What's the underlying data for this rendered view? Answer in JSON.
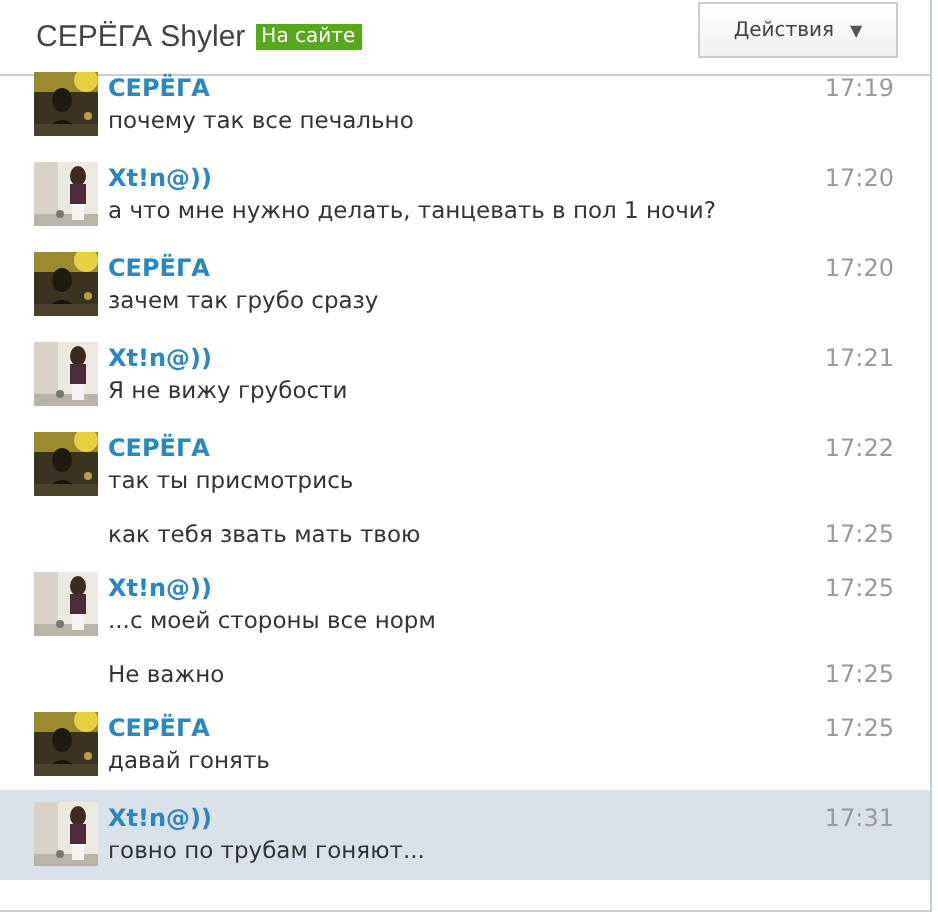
{
  "header": {
    "name": "СЕРЁГА Shyler",
    "status_badge": "На сайте",
    "actions_button": "Действия",
    "actions_caret": "▼"
  },
  "messages": [
    {
      "kind": "message",
      "author": "СЕРЁГА",
      "text": "почему так все печально",
      "time": "17:19",
      "selected": false
    },
    {
      "kind": "message",
      "author": "Xt!n@))",
      "text": "а что мне нужно делать, танцевать в пол 1 ночи?",
      "time": "17:20",
      "selected": false
    },
    {
      "kind": "message",
      "author": "СЕРЁГА",
      "text": "зачем так грубо сразу",
      "time": "17:20",
      "selected": false
    },
    {
      "kind": "message",
      "author": "Xt!n@))",
      "text": "Я не вижу грубости",
      "time": "17:21",
      "selected": false
    },
    {
      "kind": "message",
      "author": "СЕРЁГА",
      "text": "так ты присмотрись",
      "time": "17:22",
      "selected": false
    },
    {
      "kind": "continuation",
      "text": "как тебя звать мать твою",
      "time": "17:25",
      "selected": false
    },
    {
      "kind": "message",
      "author": "Xt!n@))",
      "text": "...с моей стороны все норм",
      "time": "17:25",
      "selected": false
    },
    {
      "kind": "continuation",
      "text": "Не важно",
      "time": "17:25",
      "selected": false
    },
    {
      "kind": "message",
      "author": "СЕРЁГА",
      "text": "давай гонять",
      "time": "17:25",
      "selected": false
    },
    {
      "kind": "message",
      "author": "Xt!n@))",
      "text": "говно по трубам гоняют...",
      "time": "17:31",
      "selected": true
    }
  ]
}
